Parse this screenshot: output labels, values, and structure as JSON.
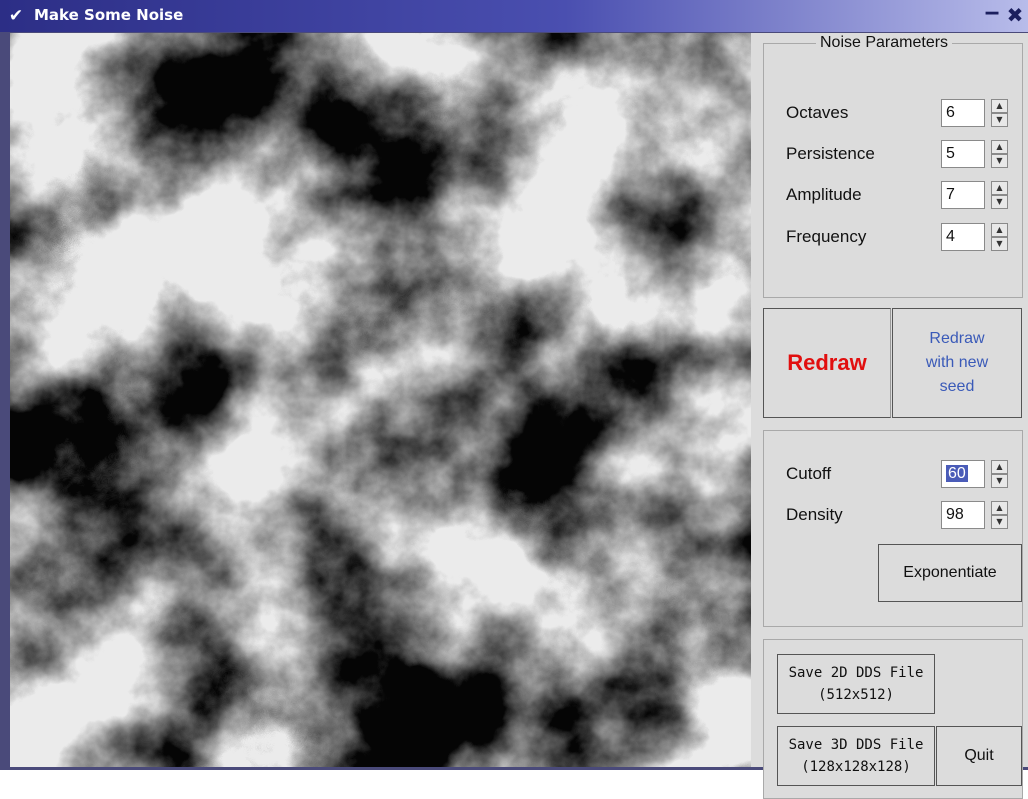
{
  "window": {
    "title": "Make Some Noise"
  },
  "params": {
    "title": "Noise Parameters",
    "fields": [
      {
        "label": "Octaves",
        "value": "6"
      },
      {
        "label": "Persistence",
        "value": "5"
      },
      {
        "label": "Amplitude",
        "value": "7"
      },
      {
        "label": "Frequency",
        "value": "4"
      }
    ]
  },
  "redraw": {
    "label": "Redraw",
    "newseed_lines": [
      "Redraw",
      "with new",
      "seed"
    ]
  },
  "cutoff": {
    "fields": [
      {
        "label": "Cutoff",
        "value": "60",
        "selected": true
      },
      {
        "label": "Density",
        "value": "98"
      }
    ],
    "exponentiate_label": "Exponentiate"
  },
  "save": {
    "save2d_lines": [
      "Save 2D DDS File",
      "(512x512)"
    ],
    "save3d_lines": [
      "Save 3D DDS File",
      "(128x128x128)"
    ],
    "quit_label": "Quit"
  },
  "colors": {
    "title_bar": "#2c2e86",
    "redraw": "#e10f0f",
    "newseed": "#3a5ab8",
    "selection": "#4a5cb8"
  }
}
